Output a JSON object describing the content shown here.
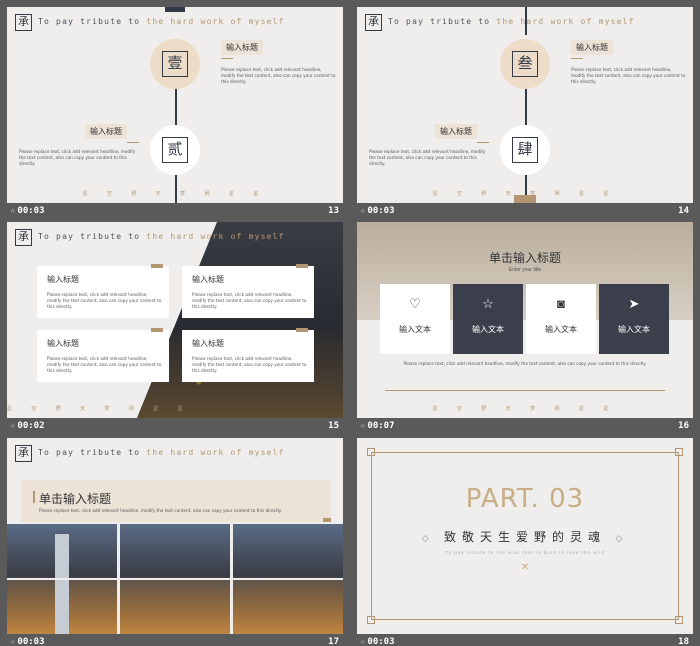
{
  "header": {
    "tribute_pre": "To pay tribute to ",
    "tribute_hl": "the hard work of myself"
  },
  "logo_glyph": "承",
  "nav_text": "星 空 野 天 梦 网 星 星",
  "lorem": "Please replace text, click add relevant headline, modify the text content, also can copy your content to this directly.",
  "lorem_long": "Please replace text, click add relevant headline, modify the text content, also can copy your content to this directly.",
  "slides": [
    {
      "time": "00:03",
      "number": "13",
      "seal1": "壹",
      "seal2": "贰",
      "title1": "输入标题",
      "title2": "输入标题"
    },
    {
      "time": "00:03",
      "number": "14",
      "seal1": "叁",
      "seal2": "肆",
      "title1": "输入标题",
      "title2": "输入标题"
    },
    {
      "time": "00:02",
      "number": "15",
      "cards": [
        "输入标题",
        "输入标题",
        "输入标题",
        "输入标题"
      ]
    },
    {
      "time": "00:07",
      "number": "16",
      "heading": "单击输入标题",
      "subheading": "Enter your title",
      "boxes": [
        {
          "icon": "heart-icon",
          "label": "输入文本"
        },
        {
          "icon": "star-icon",
          "label": "输入文本"
        },
        {
          "icon": "camera-icon",
          "label": "输入文本"
        },
        {
          "icon": "send-icon",
          "label": "输入文本"
        }
      ]
    },
    {
      "time": "00:03",
      "number": "17",
      "heading": "单击输入标题"
    },
    {
      "time": "00:03",
      "number": "18",
      "part": "PART. 03",
      "subtitle": "致敬天生爱野的灵魂",
      "small": "To pay tribute to the soul that is born to love the wild"
    }
  ],
  "colors": {
    "accent": "#b39772",
    "dark": "#333a46",
    "bg": "#efeeec",
    "grid": "#5a5a5a"
  }
}
